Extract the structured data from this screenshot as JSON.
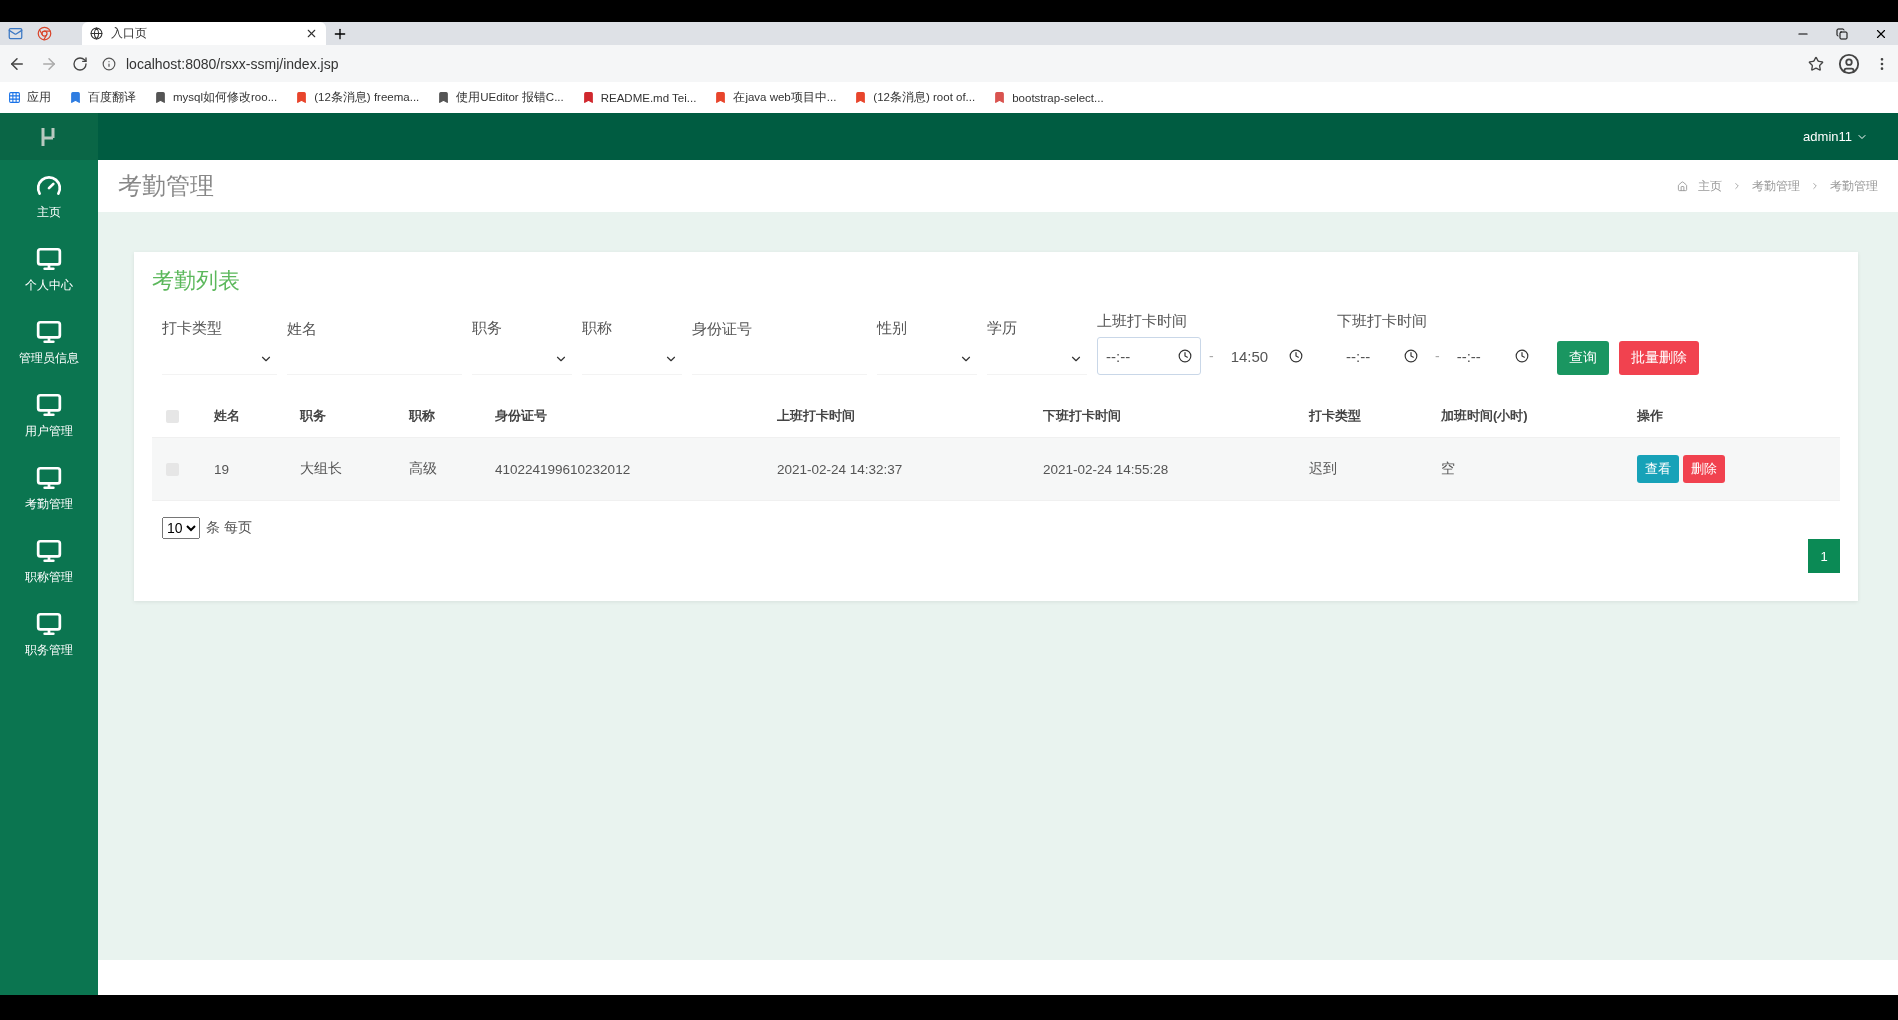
{
  "browser": {
    "tabs": [
      {
        "title": "入口页",
        "selected": true
      }
    ],
    "url": "localhost:8080/rsxx-ssmj/index.jsp",
    "apps_label": "应用",
    "bookmarks": [
      {
        "label": "百度翻译",
        "color": "#2f7de1"
      },
      {
        "label": "mysql如何修改roo...",
        "color": "#555555"
      },
      {
        "label": "(12条消息) freema...",
        "color": "#e8452c"
      },
      {
        "label": "使用UEditor 报错C...",
        "color": "#555555"
      },
      {
        "label": "README.md  Tei...",
        "color": "#d0282e"
      },
      {
        "label": "在java web项目中...",
        "color": "#e8452c"
      },
      {
        "label": "(12条消息) root of...",
        "color": "#e8452c"
      },
      {
        "label": "bootstrap-select...",
        "color": "#d9534f"
      }
    ]
  },
  "header": {
    "user": "admin11"
  },
  "sidebar": {
    "items": [
      {
        "label": "主页",
        "kind": "dashboard"
      },
      {
        "label": "个人中心",
        "kind": "monitor"
      },
      {
        "label": "管理员信息",
        "kind": "monitor"
      },
      {
        "label": "用户管理",
        "kind": "monitor"
      },
      {
        "label": "考勤管理",
        "kind": "monitor"
      },
      {
        "label": "职称管理",
        "kind": "monitor"
      },
      {
        "label": "职务管理",
        "kind": "monitor"
      }
    ]
  },
  "page": {
    "title": "考勤管理",
    "breadcrumb": [
      "主页",
      "考勤管理",
      "考勤管理"
    ]
  },
  "card": {
    "title": "考勤列表",
    "filters": [
      {
        "label": "打卡类型",
        "kind": "select"
      },
      {
        "label": "姓名",
        "kind": "text"
      },
      {
        "label": "职务",
        "kind": "select"
      },
      {
        "label": "职称",
        "kind": "select"
      },
      {
        "label": "身份证号",
        "kind": "text"
      },
      {
        "label": "性别",
        "kind": "select"
      },
      {
        "label": "学历",
        "kind": "select"
      }
    ],
    "time_ranges": [
      {
        "label": "上班打卡时间",
        "fields": [
          {
            "value": "--:--",
            "focused": true
          },
          {
            "value": "14:50",
            "focused": false
          }
        ]
      },
      {
        "label": "下班打卡时间",
        "fields": [
          {
            "value": "--:--",
            "focused": false
          },
          {
            "value": "--:--",
            "focused": false
          }
        ]
      }
    ],
    "range_separator": "-",
    "buttons": [
      {
        "label": "查询",
        "kind": "primary"
      },
      {
        "label": "批量删除",
        "kind": "danger"
      }
    ],
    "table": {
      "all_checked": false,
      "columns": [
        "姓名",
        "职务",
        "职称",
        "身份证号",
        "上班打卡时间",
        "下班打卡时间",
        "打卡类型",
        "加班时间(小时)",
        "操作"
      ],
      "rows": [
        {
          "checked": false,
          "cells": [
            "19",
            "大组长",
            "高级",
            "410224199610232012",
            "2021-02-24 14:32:37",
            "2021-02-24 14:55:28",
            "迟到",
            "空"
          ],
          "actions": [
            {
              "label": "查看",
              "kind": "info"
            },
            {
              "label": "删除",
              "kind": "danger"
            }
          ]
        }
      ]
    },
    "page_size": "10",
    "page_size_label": "条 每页",
    "pages": [
      {
        "label": "1",
        "selected": true
      }
    ]
  }
}
